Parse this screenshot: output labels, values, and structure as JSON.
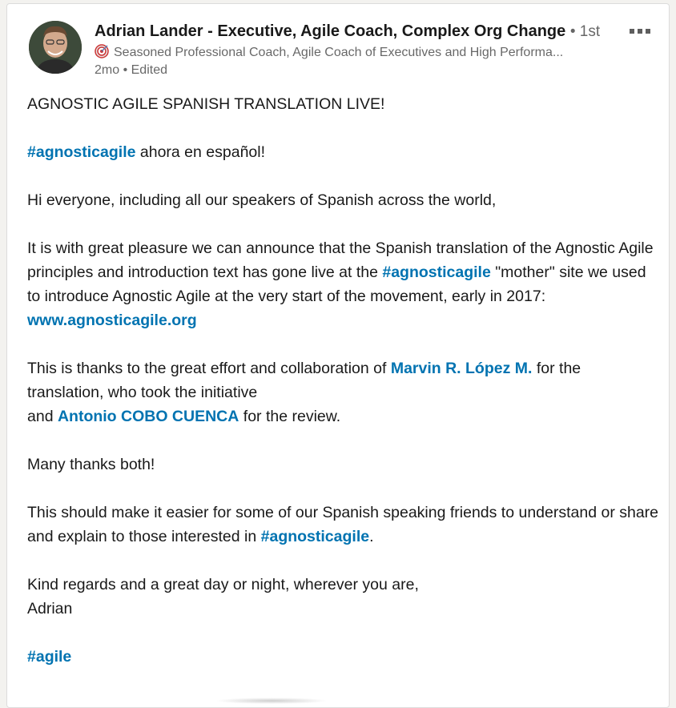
{
  "post": {
    "actor": {
      "name": "Adrian Lander - Executive, Agile Coach, Complex Org Change",
      "degree": "• 1st",
      "description": "Seasoned Professional Coach, Agile Coach of Executives and High Performa...",
      "meta": "2mo • Edited"
    },
    "icons": {
      "avatar": "profile-photo",
      "description_prefix": "target-icon",
      "more": "more-options-icon"
    },
    "body": {
      "line1": "AGNOSTIC AGILE SPANISH TRANSLATION LIVE!",
      "hashtag1": "#agnosticagile",
      "line2_rest": " ahora en español!",
      "line3": "Hi everyone, including all our speakers of Spanish across the world,",
      "line4a": "It is with great pleasure we can announce that the Spanish translation of the Agnostic Agile principles and introduction text has gone live at the ",
      "hashtag2": "#agnosticagile",
      "line4b": " \"mother\" site we used to introduce Agnostic Agile at the very start of the movement, early in 2017:",
      "url": "www.agnosticagile.org",
      "line5a": "This is thanks to the great effort and collaboration of ",
      "mention1": "Marvin R. López M.",
      "line5b": " for the translation, who took the initiative",
      "line5c": "and ",
      "mention2": "Antonio COBO CUENCA",
      "line5d": " for the review.",
      "line6": "Many thanks both!",
      "line7a": "This should make it easier for some of our Spanish speaking friends to understand or share and explain to those interested in ",
      "hashtag3": "#agnosticagile",
      "line7b": ".",
      "line8a": "Kind regards and a great day or night, wherever you are,",
      "line8b": "Adrian",
      "hashtag4": "#agile"
    }
  },
  "colors": {
    "link": "#0073b1",
    "text": "#191919",
    "muted": "#666666"
  }
}
